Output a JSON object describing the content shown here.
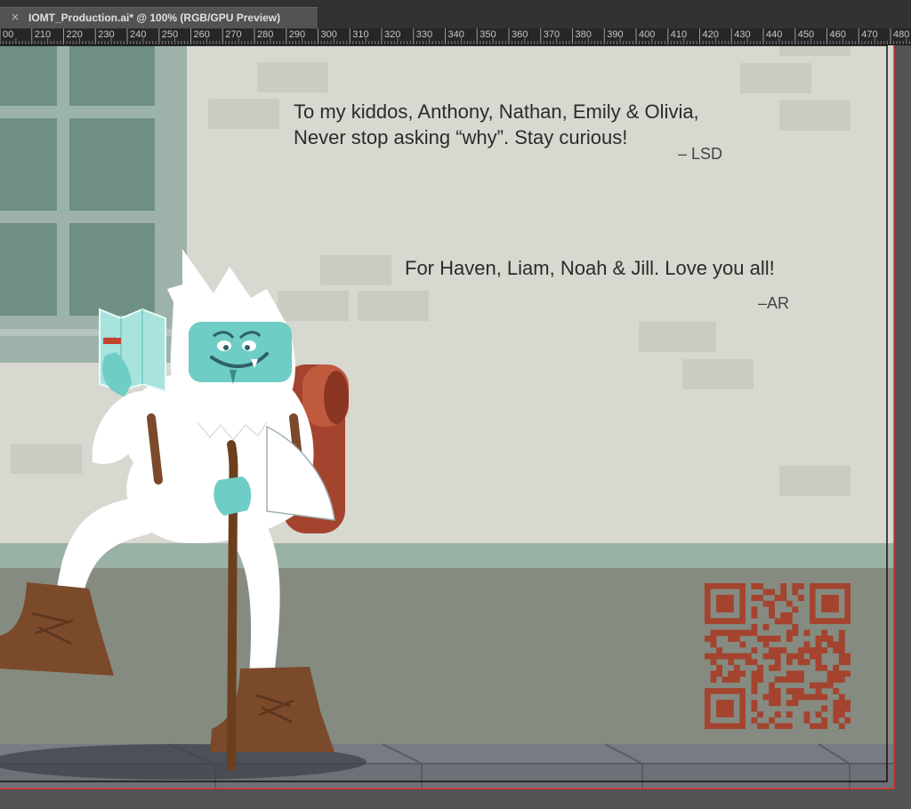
{
  "document_tab": {
    "title": "IOMT_Production.ai* @ 100% (RGB/GPU Preview)",
    "close_symbol": "×"
  },
  "ruler": {
    "labels": [
      "00",
      "210",
      "220",
      "230",
      "240",
      "250",
      "260",
      "270",
      "280",
      "290",
      "300",
      "310",
      "320",
      "330",
      "340",
      "350",
      "360",
      "370",
      "380",
      "390",
      "400",
      "410",
      "420",
      "430",
      "440",
      "450",
      "460",
      "470",
      "480"
    ]
  },
  "artwork": {
    "dedication_1": {
      "line_1": "To my kiddos, Anthony, Nathan, Emily & Olivia,",
      "line_2": "Never stop asking “why”. Stay curious!",
      "signature": "– LSD"
    },
    "dedication_2": {
      "line_1": "For Haven, Liam, Noah & Jill. Love you all!",
      "signature": "–AR"
    },
    "map_label": "MAP",
    "colors": {
      "wall": "#d7d8d0",
      "brick": "#c8cbc2",
      "window": "#6f8f83",
      "window_frame": "#9db3a9",
      "baseboard": "#9ab1a5",
      "floor": "#858b80",
      "sidewalk": "#6e7077",
      "yeti_fur": "#ffffff",
      "yeti_face": "#6ecdc4",
      "backpack": "#a4432e",
      "boots": "#7a4a2a",
      "qr": "#a4432e"
    }
  }
}
